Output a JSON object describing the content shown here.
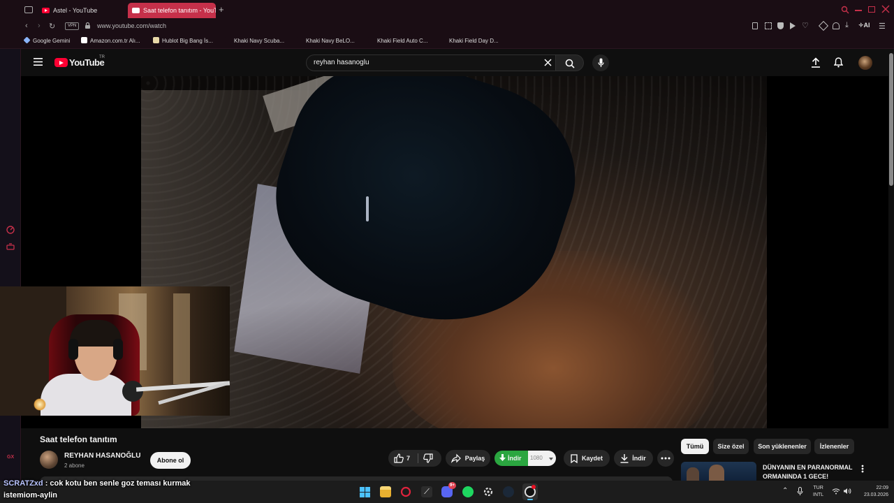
{
  "browser": {
    "tabs": [
      {
        "label": "Astel - YouTube",
        "active": false
      },
      {
        "label": "Saat telefon tanıtım - YouT",
        "active": true
      }
    ],
    "vpn_label": "VPN",
    "url": "www.youtube.com/watch",
    "ai_label": "AI",
    "bookmarks": [
      {
        "label": "Google Gemini",
        "icon": "gemini-icon"
      },
      {
        "label": "Amazon.com.tr Alı...",
        "icon": "amazon-icon"
      },
      {
        "label": "Hublot Big Bang İs...",
        "icon": "hublot-icon"
      },
      {
        "label": "Khaki Navy Scuba...",
        "icon": "hamilton-icon"
      },
      {
        "label": "Khaki Navy BeLO...",
        "icon": "hamilton-icon"
      },
      {
        "label": "Khaki Field Auto C...",
        "icon": "hamilton-icon"
      },
      {
        "label": "Khaki Field Day D...",
        "icon": "hamilton-icon"
      }
    ]
  },
  "youtube": {
    "logo_text": "YouTube",
    "region": "TR",
    "search_value": "reyhan hasanoglu",
    "video_title": "Saat telefon tanıtım",
    "channel_name": "REYHAN HASANOĞLU",
    "subscribers": "2 abone",
    "subscribe_label": "Abone ol",
    "like_count": "7",
    "share_label": "Paylaş",
    "download_ext_label": "İndir",
    "quality_label": "1080",
    "save_label": "Kaydet",
    "download_label": "İndir",
    "chips": [
      "Tümü",
      "Size özel",
      "Son yüklenenler",
      "İzlenenler"
    ],
    "recommended_title_line1": "DÜNYANIN EN PARANORMAL",
    "recommended_title_line2": "ORMANINDA 1 GECE!"
  },
  "overlay": {
    "chat_user": "SCRATZxd",
    "chat_message": " : cok kotu ben senle goz teması kurmak",
    "chat_line2": "istemiom-aylin",
    "side_text": "GX"
  },
  "taskbar": {
    "lang_line1": "TUR",
    "lang_line2": "INTL",
    "time": "22:09",
    "date": "23.03.2026",
    "discord_badge": "9+"
  },
  "colors": {
    "opera_red": "#c6304a",
    "download_green": "#2ba640",
    "youtube_red": "#ff0033"
  }
}
